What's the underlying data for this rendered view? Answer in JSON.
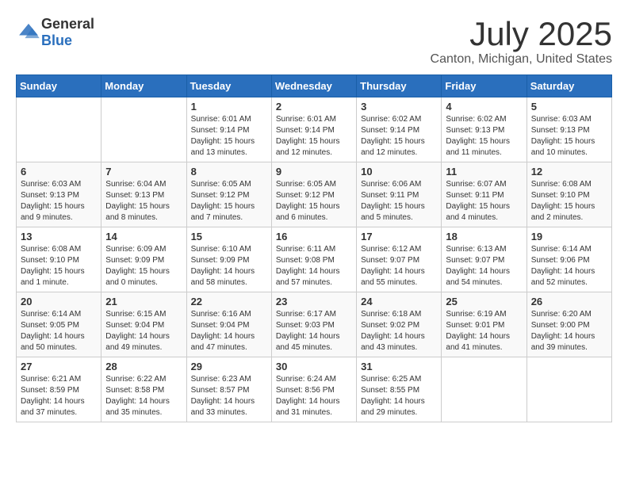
{
  "header": {
    "logo_general": "General",
    "logo_blue": "Blue",
    "month": "July 2025",
    "location": "Canton, Michigan, United States"
  },
  "weekdays": [
    "Sunday",
    "Monday",
    "Tuesday",
    "Wednesday",
    "Thursday",
    "Friday",
    "Saturday"
  ],
  "weeks": [
    [
      {
        "day": "",
        "sunrise": "",
        "sunset": "",
        "daylight": ""
      },
      {
        "day": "",
        "sunrise": "",
        "sunset": "",
        "daylight": ""
      },
      {
        "day": "1",
        "sunrise": "Sunrise: 6:01 AM",
        "sunset": "Sunset: 9:14 PM",
        "daylight": "Daylight: 15 hours and 13 minutes."
      },
      {
        "day": "2",
        "sunrise": "Sunrise: 6:01 AM",
        "sunset": "Sunset: 9:14 PM",
        "daylight": "Daylight: 15 hours and 12 minutes."
      },
      {
        "day": "3",
        "sunrise": "Sunrise: 6:02 AM",
        "sunset": "Sunset: 9:14 PM",
        "daylight": "Daylight: 15 hours and 12 minutes."
      },
      {
        "day": "4",
        "sunrise": "Sunrise: 6:02 AM",
        "sunset": "Sunset: 9:13 PM",
        "daylight": "Daylight: 15 hours and 11 minutes."
      },
      {
        "day": "5",
        "sunrise": "Sunrise: 6:03 AM",
        "sunset": "Sunset: 9:13 PM",
        "daylight": "Daylight: 15 hours and 10 minutes."
      }
    ],
    [
      {
        "day": "6",
        "sunrise": "Sunrise: 6:03 AM",
        "sunset": "Sunset: 9:13 PM",
        "daylight": "Daylight: 15 hours and 9 minutes."
      },
      {
        "day": "7",
        "sunrise": "Sunrise: 6:04 AM",
        "sunset": "Sunset: 9:13 PM",
        "daylight": "Daylight: 15 hours and 8 minutes."
      },
      {
        "day": "8",
        "sunrise": "Sunrise: 6:05 AM",
        "sunset": "Sunset: 9:12 PM",
        "daylight": "Daylight: 15 hours and 7 minutes."
      },
      {
        "day": "9",
        "sunrise": "Sunrise: 6:05 AM",
        "sunset": "Sunset: 9:12 PM",
        "daylight": "Daylight: 15 hours and 6 minutes."
      },
      {
        "day": "10",
        "sunrise": "Sunrise: 6:06 AM",
        "sunset": "Sunset: 9:11 PM",
        "daylight": "Daylight: 15 hours and 5 minutes."
      },
      {
        "day": "11",
        "sunrise": "Sunrise: 6:07 AM",
        "sunset": "Sunset: 9:11 PM",
        "daylight": "Daylight: 15 hours and 4 minutes."
      },
      {
        "day": "12",
        "sunrise": "Sunrise: 6:08 AM",
        "sunset": "Sunset: 9:10 PM",
        "daylight": "Daylight: 15 hours and 2 minutes."
      }
    ],
    [
      {
        "day": "13",
        "sunrise": "Sunrise: 6:08 AM",
        "sunset": "Sunset: 9:10 PM",
        "daylight": "Daylight: 15 hours and 1 minute."
      },
      {
        "day": "14",
        "sunrise": "Sunrise: 6:09 AM",
        "sunset": "Sunset: 9:09 PM",
        "daylight": "Daylight: 15 hours and 0 minutes."
      },
      {
        "day": "15",
        "sunrise": "Sunrise: 6:10 AM",
        "sunset": "Sunset: 9:09 PM",
        "daylight": "Daylight: 14 hours and 58 minutes."
      },
      {
        "day": "16",
        "sunrise": "Sunrise: 6:11 AM",
        "sunset": "Sunset: 9:08 PM",
        "daylight": "Daylight: 14 hours and 57 minutes."
      },
      {
        "day": "17",
        "sunrise": "Sunrise: 6:12 AM",
        "sunset": "Sunset: 9:07 PM",
        "daylight": "Daylight: 14 hours and 55 minutes."
      },
      {
        "day": "18",
        "sunrise": "Sunrise: 6:13 AM",
        "sunset": "Sunset: 9:07 PM",
        "daylight": "Daylight: 14 hours and 54 minutes."
      },
      {
        "day": "19",
        "sunrise": "Sunrise: 6:14 AM",
        "sunset": "Sunset: 9:06 PM",
        "daylight": "Daylight: 14 hours and 52 minutes."
      }
    ],
    [
      {
        "day": "20",
        "sunrise": "Sunrise: 6:14 AM",
        "sunset": "Sunset: 9:05 PM",
        "daylight": "Daylight: 14 hours and 50 minutes."
      },
      {
        "day": "21",
        "sunrise": "Sunrise: 6:15 AM",
        "sunset": "Sunset: 9:04 PM",
        "daylight": "Daylight: 14 hours and 49 minutes."
      },
      {
        "day": "22",
        "sunrise": "Sunrise: 6:16 AM",
        "sunset": "Sunset: 9:04 PM",
        "daylight": "Daylight: 14 hours and 47 minutes."
      },
      {
        "day": "23",
        "sunrise": "Sunrise: 6:17 AM",
        "sunset": "Sunset: 9:03 PM",
        "daylight": "Daylight: 14 hours and 45 minutes."
      },
      {
        "day": "24",
        "sunrise": "Sunrise: 6:18 AM",
        "sunset": "Sunset: 9:02 PM",
        "daylight": "Daylight: 14 hours and 43 minutes."
      },
      {
        "day": "25",
        "sunrise": "Sunrise: 6:19 AM",
        "sunset": "Sunset: 9:01 PM",
        "daylight": "Daylight: 14 hours and 41 minutes."
      },
      {
        "day": "26",
        "sunrise": "Sunrise: 6:20 AM",
        "sunset": "Sunset: 9:00 PM",
        "daylight": "Daylight: 14 hours and 39 minutes."
      }
    ],
    [
      {
        "day": "27",
        "sunrise": "Sunrise: 6:21 AM",
        "sunset": "Sunset: 8:59 PM",
        "daylight": "Daylight: 14 hours and 37 minutes."
      },
      {
        "day": "28",
        "sunrise": "Sunrise: 6:22 AM",
        "sunset": "Sunset: 8:58 PM",
        "daylight": "Daylight: 14 hours and 35 minutes."
      },
      {
        "day": "29",
        "sunrise": "Sunrise: 6:23 AM",
        "sunset": "Sunset: 8:57 PM",
        "daylight": "Daylight: 14 hours and 33 minutes."
      },
      {
        "day": "30",
        "sunrise": "Sunrise: 6:24 AM",
        "sunset": "Sunset: 8:56 PM",
        "daylight": "Daylight: 14 hours and 31 minutes."
      },
      {
        "day": "31",
        "sunrise": "Sunrise: 6:25 AM",
        "sunset": "Sunset: 8:55 PM",
        "daylight": "Daylight: 14 hours and 29 minutes."
      },
      {
        "day": "",
        "sunrise": "",
        "sunset": "",
        "daylight": ""
      },
      {
        "day": "",
        "sunrise": "",
        "sunset": "",
        "daylight": ""
      }
    ]
  ]
}
